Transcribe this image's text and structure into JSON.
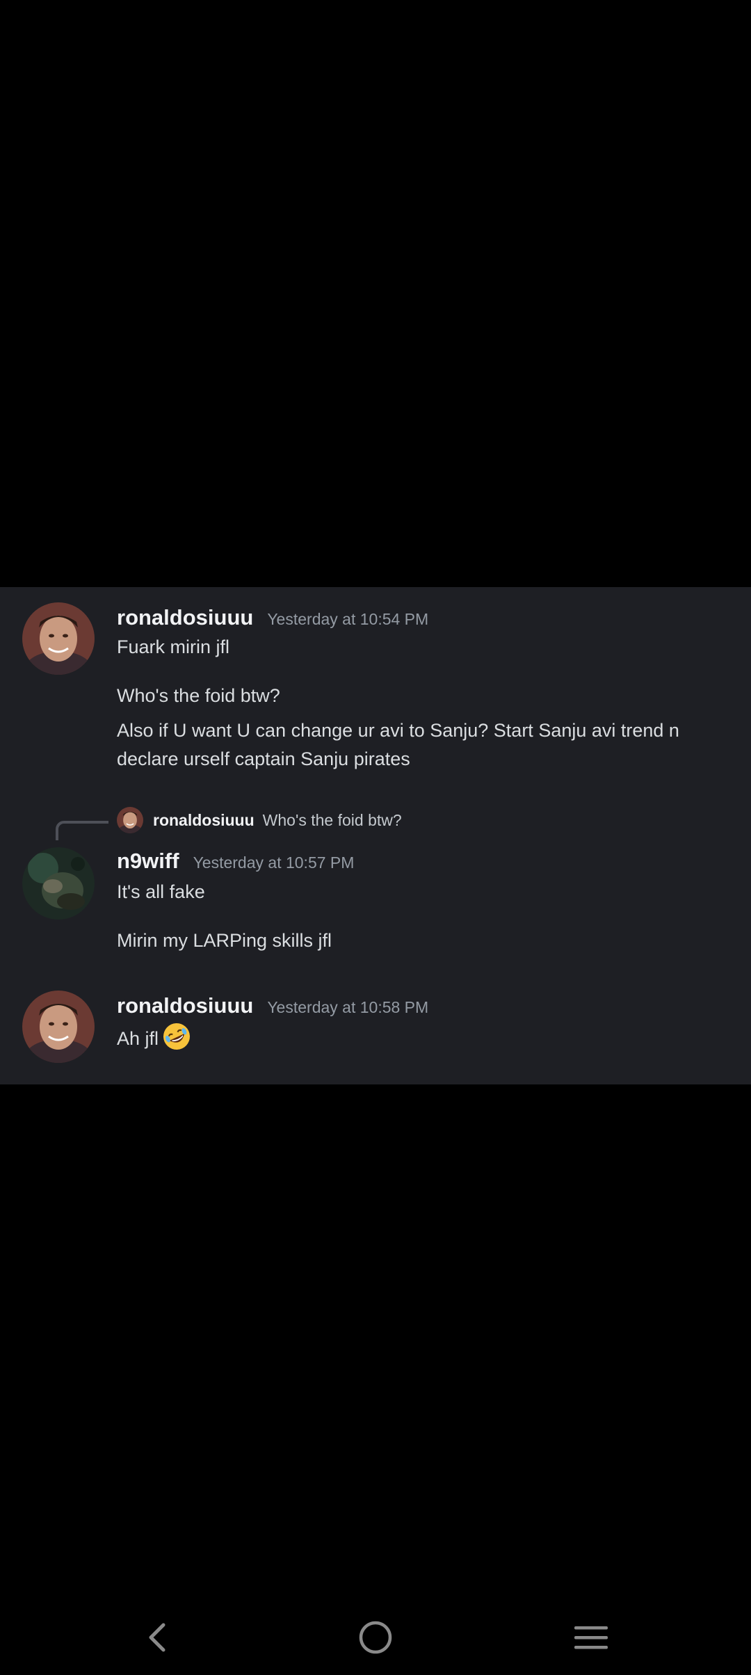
{
  "messages": [
    {
      "username": "ronaldosiuuu",
      "timestamp": "Yesterday at 10:54 PM",
      "lines": [
        "Fuark mirin jfl",
        "Who's the foid btw?",
        "Also if U want U can change ur avi to Sanju? Start Sanju avi trend n declare urself captain Sanju pirates"
      ]
    },
    {
      "reply": {
        "username": "ronaldosiuuu",
        "text": "Who's the foid btw?"
      },
      "username": "n9wiff",
      "timestamp": "Yesterday at 10:57 PM",
      "lines": [
        "It's all fake",
        "Mirin my LARPing skills jfl"
      ]
    },
    {
      "username": "ronaldosiuuu",
      "timestamp": "Yesterday at 10:58 PM",
      "lines": [
        "Ah jfl"
      ],
      "emoji": "rolling-on-the-floor-laughing-emoji"
    }
  ],
  "nav": {
    "back": "back-icon",
    "home": "home-icon",
    "recents": "recents-icon"
  },
  "colors": {
    "panel_bg": "#1e1f24",
    "screen_bg": "#000000",
    "username": "#f2f3f5",
    "timestamp": "#949ba4",
    "message_text": "#dbdee1"
  }
}
